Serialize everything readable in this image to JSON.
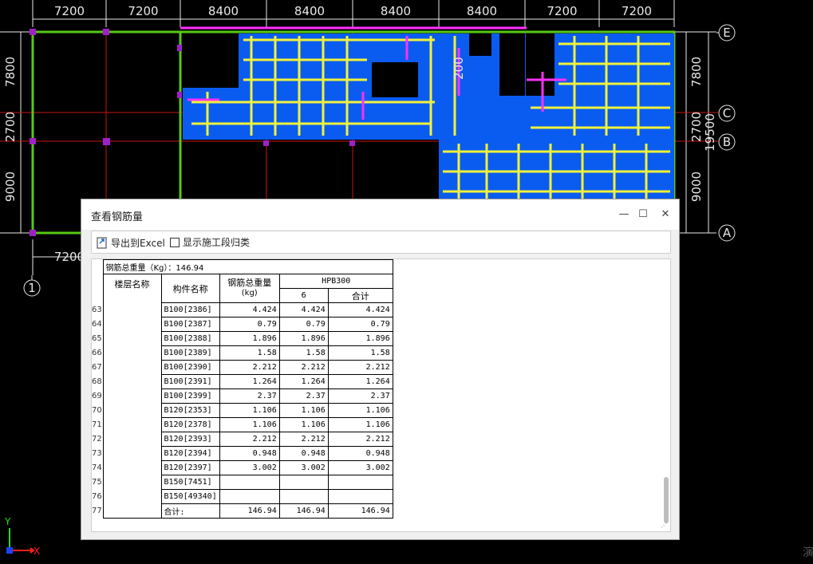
{
  "drawing": {
    "top_dims": [
      "7200",
      "7200",
      "8400",
      "8400",
      "8400",
      "8400",
      "7200",
      "7200"
    ],
    "bottom_dim": "7200",
    "left_dims": [
      "7800",
      "2700",
      "9000"
    ],
    "right_dims": [
      "7800",
      "2700",
      "9000"
    ],
    "right_total": "19500",
    "axis_labels": [
      "E",
      "C",
      "B",
      "A"
    ],
    "col_label": "1",
    "inner_label": "200",
    "colors": {
      "slab": "#0a5cf0",
      "bar": "#f2f23a",
      "magenta": "#ff30ff",
      "grid": "#c81414",
      "wall": "#58c814"
    }
  },
  "dialog": {
    "title": "查看钢筋量",
    "minimize": "—",
    "maximize": "☐",
    "close": "✕",
    "export_label": "导出到Excel",
    "show_stage_label": "显示施工段归类",
    "summary": "钢筋总重量（Kg）：146.94",
    "headers": {
      "floor": "楼层名称",
      "component": "构件名称",
      "total": "钢筋总重量",
      "total_unit": "(kg)",
      "grade": "HPB300",
      "dia": "6",
      "sum": "合计"
    },
    "rows": [
      {
        "n": "63",
        "name": "B100[2386]",
        "total": "4.424",
        "d6": "4.424",
        "sum": "4.424"
      },
      {
        "n": "64",
        "name": "B100[2387]",
        "total": "0.79",
        "d6": "0.79",
        "sum": "0.79"
      },
      {
        "n": "65",
        "name": "B100[2388]",
        "total": "1.896",
        "d6": "1.896",
        "sum": "1.896"
      },
      {
        "n": "66",
        "name": "B100[2389]",
        "total": "1.58",
        "d6": "1.58",
        "sum": "1.58"
      },
      {
        "n": "67",
        "name": "B100[2390]",
        "total": "2.212",
        "d6": "2.212",
        "sum": "2.212"
      },
      {
        "n": "68",
        "name": "B100[2391]",
        "total": "1.264",
        "d6": "1.264",
        "sum": "1.264"
      },
      {
        "n": "69",
        "name": "B100[2399]",
        "total": "2.37",
        "d6": "2.37",
        "sum": "2.37"
      },
      {
        "n": "70",
        "name": "B120[2353]",
        "total": "1.106",
        "d6": "1.106",
        "sum": "1.106"
      },
      {
        "n": "71",
        "name": "B120[2378]",
        "total": "1.106",
        "d6": "1.106",
        "sum": "1.106"
      },
      {
        "n": "72",
        "name": "B120[2393]",
        "total": "2.212",
        "d6": "2.212",
        "sum": "2.212"
      },
      {
        "n": "73",
        "name": "B120[2394]",
        "total": "0.948",
        "d6": "0.948",
        "sum": "0.948"
      },
      {
        "n": "74",
        "name": "B120[2397]",
        "total": "3.002",
        "d6": "3.002",
        "sum": "3.002"
      },
      {
        "n": "75",
        "name": "B150[7451]",
        "total": "",
        "d6": "",
        "sum": ""
      },
      {
        "n": "76",
        "name": "B150[49340]",
        "total": "",
        "d6": "",
        "sum": ""
      },
      {
        "n": "77",
        "name": "合计:",
        "total": "146.94",
        "d6": "146.94",
        "sum": "146.94"
      }
    ]
  },
  "corner": {
    "y_axis": "Y",
    "x_axis": "X",
    "edge_text": "演"
  }
}
